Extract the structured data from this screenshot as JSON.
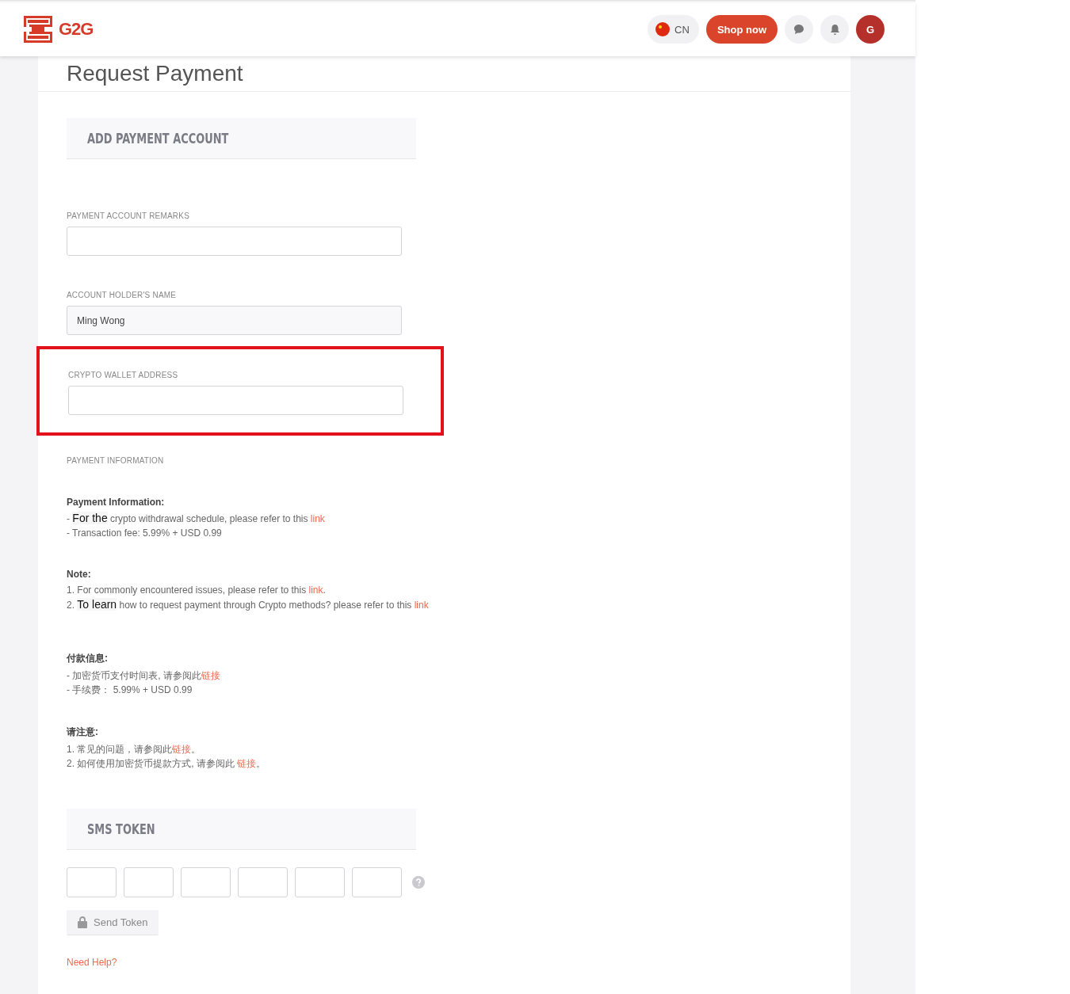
{
  "header": {
    "logo": "G2G",
    "language": "CN",
    "shop_button": "Shop now",
    "avatar": "G"
  },
  "page_title": "Request Payment",
  "section_title": "ADD PAYMENT ACCOUNT",
  "fields": [
    {
      "label": "PAYMENT ACCOUNT REMARKS",
      "highlighted": false
    },
    {
      "label": "ACCOUNT HOLDER'S NAME",
      "value": "Ming Wong",
      "highlighted": false
    },
    {
      "label": "CRYPTO WALLET ADDRESS",
      "highlighted": true
    }
  ],
  "payment_information_label": "PAYMENT INFORMATION",
  "info_blocks": [
    {
      "heading": "Payment Information:",
      "lines": [
        [
          {
            "kind": "plain",
            "text": "- "
          },
          {
            "kind": "pasted",
            "text": "For the"
          },
          {
            "kind": "plain",
            "text": " crypto withdrawal schedule, please refer to this "
          },
          {
            "kind": "link",
            "text": "link"
          }
        ],
        [
          {
            "kind": "plain",
            "text": "- Transaction fee: 5.99% + USD 0.99"
          }
        ]
      ]
    },
    {
      "heading": "Note:",
      "lines": [
        [
          {
            "kind": "plain",
            "text": "1. For commonly encountered issues, please refer to this "
          },
          {
            "kind": "link",
            "text": "link"
          },
          {
            "kind": "plain",
            "text": "."
          }
        ],
        [
          {
            "kind": "plain",
            "text": "2. "
          },
          {
            "kind": "pasted",
            "text": "To learn"
          },
          {
            "kind": "plain",
            "text": " how to request payment through Crypto methods? please refer to this "
          },
          {
            "kind": "link",
            "text": "link"
          }
        ]
      ]
    },
    {
      "heading": "付款信息:",
      "lines": [
        [
          {
            "kind": "plain",
            "text": "- 加密货币支付时间表, 请参阅此"
          },
          {
            "kind": "link",
            "text": "链接"
          }
        ],
        [
          {
            "kind": "plain",
            "text": "- 手续费： 5.99% + USD 0.99"
          }
        ]
      ]
    },
    {
      "heading": "请注意:",
      "lines": [
        [
          {
            "kind": "plain",
            "text": "1. 常见的问题，请参阅此"
          },
          {
            "kind": "link",
            "text": "链接"
          },
          {
            "kind": "plain",
            "text": "。"
          }
        ],
        [
          {
            "kind": "plain",
            "text": "2. 如何使用加密货币提款方式, 请参阅此 "
          },
          {
            "kind": "link",
            "text": "链接"
          },
          {
            "kind": "plain",
            "text": "。"
          }
        ]
      ]
    }
  ],
  "sms_title": "SMS TOKEN",
  "token_digits": [
    {
      "kind": "digit"
    },
    {
      "kind": "digit"
    },
    {
      "kind": "digit"
    },
    {
      "kind": "digit"
    },
    {
      "kind": "digit"
    },
    {
      "kind": "digit"
    }
  ],
  "send_token_button": "Send Token",
  "help_link": "Need Help?"
}
